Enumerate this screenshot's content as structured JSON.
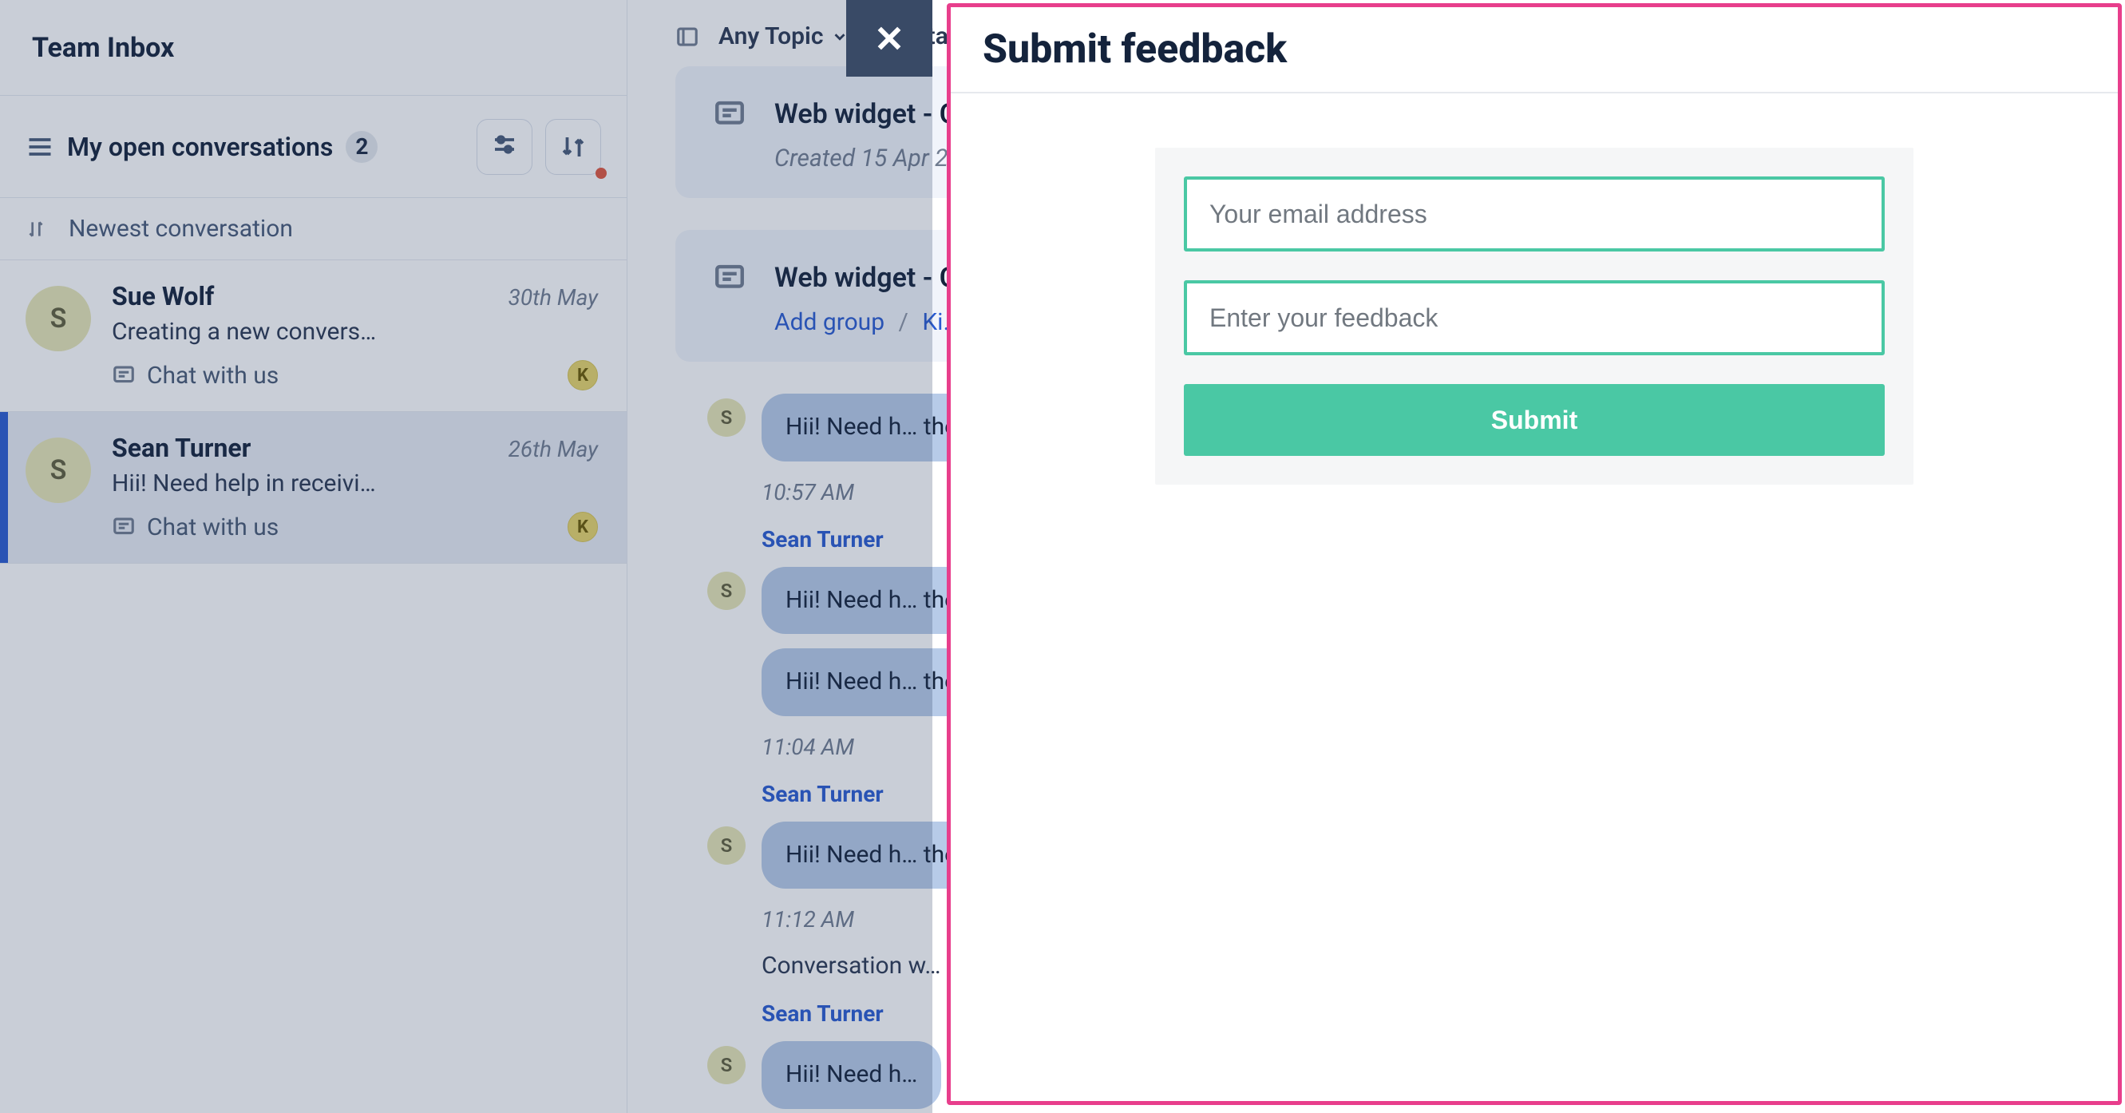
{
  "sidebar": {
    "title": "Team Inbox",
    "filter_name": "My open conversations",
    "count": "2",
    "sort_label": "Newest conversation",
    "items": [
      {
        "initial": "S",
        "name": "Sue Wolf",
        "date": "30th May",
        "preview": "Creating a new convers…",
        "source": "Chat with us",
        "agent": "K"
      },
      {
        "initial": "S",
        "name": "Sean Turner",
        "date": "26th May",
        "preview": "Hii! Need help in receivi…",
        "source": "Chat with us",
        "agent": "K"
      }
    ]
  },
  "toolbar": {
    "topic": "Any Topic",
    "status": "Any statu…"
  },
  "cards": [
    {
      "title": "Web widget - C…",
      "sub": "Created 15 Apr 2…"
    },
    {
      "title": "Web widget - C…",
      "add_group": "Add group",
      "extra": "Ki…"
    }
  ],
  "thread": {
    "author": "Sean Turner",
    "avatar_initial": "S",
    "system": "Conversation w…",
    "messages": [
      {
        "text": "Hii! Need h… the cancell…",
        "time": "10:57 AM"
      },
      {
        "text": "Hii! Need h… the cancell…",
        "time": ""
      },
      {
        "text": "Hii! Need h… the cancell…",
        "time": "11:04 AM"
      },
      {
        "text": "Hii! Need h… the cancell…",
        "time": "11:12 AM"
      },
      {
        "text": "Hii! Need h…",
        "time": ""
      }
    ]
  },
  "panel": {
    "title": "Submit feedback",
    "email_placeholder": "Your email address",
    "feedback_placeholder": "Enter your feedback",
    "submit_label": "Submit"
  }
}
